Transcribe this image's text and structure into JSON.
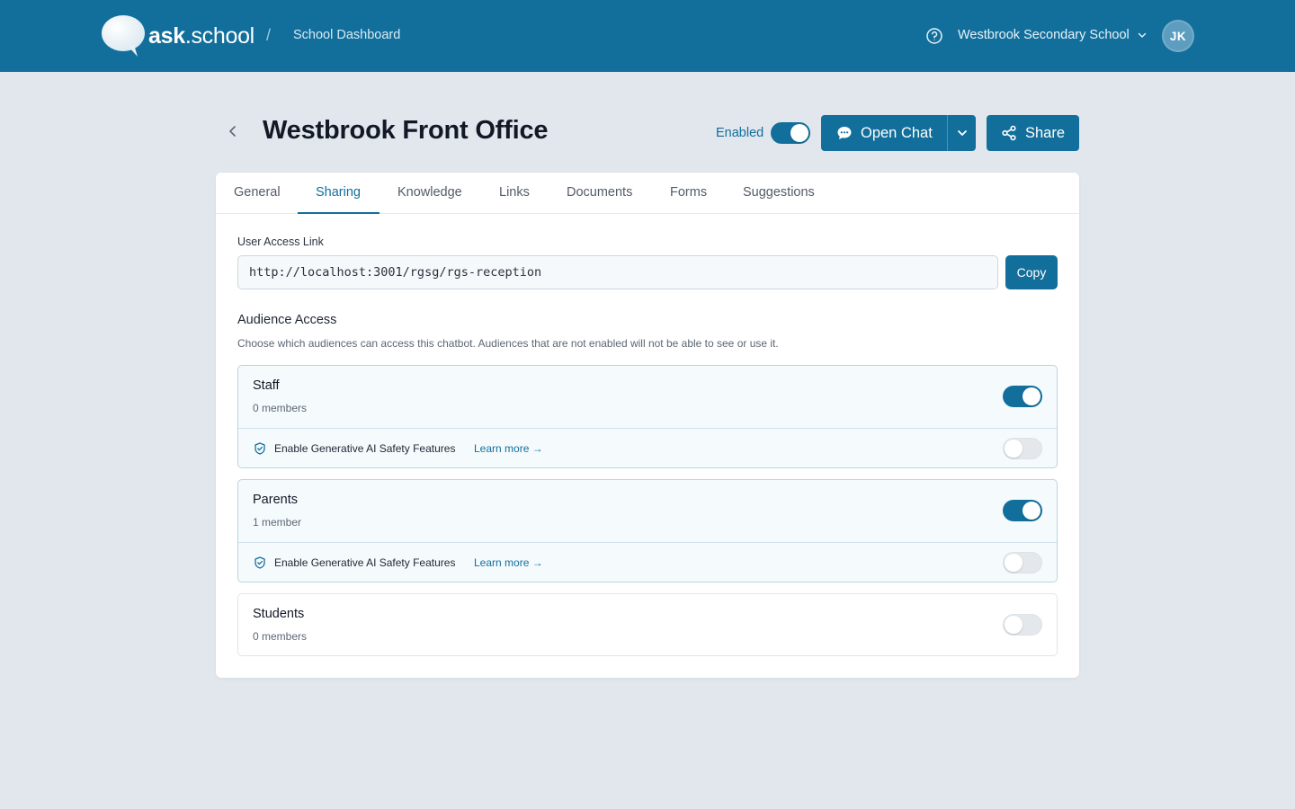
{
  "header": {
    "brand_bold": "ask",
    "brand_light": ".school",
    "breadcrumb_separator": "/",
    "breadcrumb": "School Dashboard",
    "school_name": "Westbrook Secondary School",
    "avatar_initials": "JK"
  },
  "page": {
    "title": "Westbrook Front Office",
    "enabled_label": "Enabled",
    "enabled": true,
    "open_chat_label": "Open Chat",
    "share_label": "Share"
  },
  "tabs": [
    {
      "label": "General",
      "active": false
    },
    {
      "label": "Sharing",
      "active": true
    },
    {
      "label": "Knowledge",
      "active": false
    },
    {
      "label": "Links",
      "active": false
    },
    {
      "label": "Documents",
      "active": false
    },
    {
      "label": "Forms",
      "active": false
    },
    {
      "label": "Suggestions",
      "active": false
    }
  ],
  "sharing": {
    "access_link_label": "User Access Link",
    "access_link_value": "http://localhost:3001/rgsg/rgs-reception",
    "copy_label": "Copy",
    "audience_title": "Audience Access",
    "audience_description": "Choose which audiences can access this chatbot. Audiences that are not enabled will not be able to see or use it.",
    "audiences": [
      {
        "name": "Staff",
        "count": "0 members",
        "enabled": true,
        "safety_label": "Enable Generative AI Safety Features",
        "learn_more": "Learn more →",
        "safety_enabled": false
      },
      {
        "name": "Parents",
        "count": "1 member",
        "enabled": true,
        "safety_label": "Enable Generative AI Safety Features",
        "learn_more": "Learn more →",
        "safety_enabled": false
      },
      {
        "name": "Students",
        "count": "0 members",
        "enabled": false
      }
    ]
  },
  "colors": {
    "primary": "#126f9c",
    "background": "#e1e7ec",
    "card": "#ffffff"
  }
}
